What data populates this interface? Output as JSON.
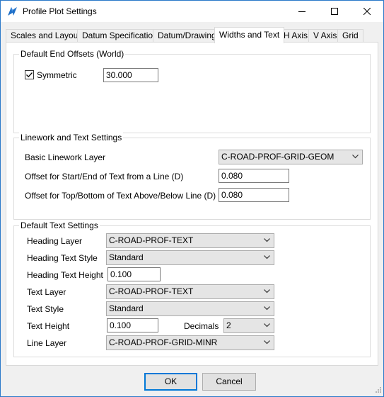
{
  "window": {
    "title": "Profile Plot Settings",
    "minimize_icon": "minimize-icon",
    "maximize_icon": "maximize-icon",
    "close_icon": "close-icon"
  },
  "tabs": [
    {
      "label": "Scales and Layout",
      "active": false
    },
    {
      "label": "Datum Specification",
      "active": false
    },
    {
      "label": "Datum/Drawing",
      "active": false
    },
    {
      "label": "Widths and Text",
      "active": true
    },
    {
      "label": "H Axis",
      "active": false
    },
    {
      "label": "V Axis",
      "active": false
    },
    {
      "label": "Grid",
      "active": false
    }
  ],
  "end_offsets": {
    "title": "Default End Offsets (World)",
    "symmetric_label": "Symmetric",
    "symmetric_checked": true,
    "offset_value": "30.000"
  },
  "linework": {
    "title": "Linework and Text Settings",
    "layer_label": "Basic Linework Layer",
    "layer_value": "C-ROAD-PROF-GRID-GEOM",
    "start_end_label": "Offset for Start/End of Text from a Line (D)",
    "start_end_value": "0.080",
    "top_bottom_label": "Offset for Top/Bottom of Text Above/Below Line (D)",
    "top_bottom_value": "0.080"
  },
  "text_settings": {
    "title": "Default Text Settings",
    "heading_layer_label": "Heading Layer",
    "heading_layer_value": "C-ROAD-PROF-TEXT",
    "heading_style_label": "Heading Text Style",
    "heading_style_value": "Standard",
    "heading_height_label": "Heading Text Height",
    "heading_height_value": "0.100",
    "text_layer_label": "Text Layer",
    "text_layer_value": "C-ROAD-PROF-TEXT",
    "text_style_label": "Text Style",
    "text_style_value": "Standard",
    "text_height_label": "Text Height",
    "text_height_value": "0.100",
    "decimals_label": "Decimals",
    "decimals_value": "2",
    "line_layer_label": "Line Layer",
    "line_layer_value": "C-ROAD-PROF-GRID-MINR"
  },
  "footer": {
    "ok_label": "OK",
    "cancel_label": "Cancel"
  },
  "colors": {
    "window_border": "#2b79c9",
    "default_button_border": "#0078d7"
  }
}
